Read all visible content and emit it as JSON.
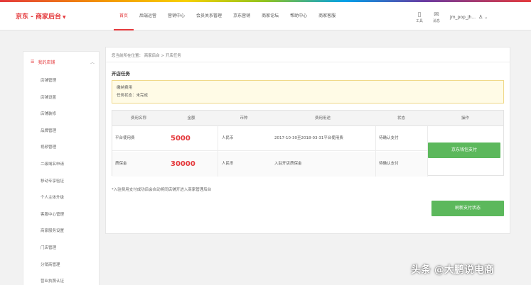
{
  "header": {
    "logo": "京东 - 商家后台",
    "nav": [
      "首页",
      "后端运营",
      "营销中心",
      "会员关系管理",
      "京东营销",
      "商家论坛",
      "帮助中心",
      "商家客服"
    ],
    "active_nav": 0,
    "icons": [
      {
        "icon": "mobile-icon",
        "label": "工具"
      },
      {
        "icon": "message-icon",
        "label": "消息"
      }
    ],
    "user": "jm_pop_jh..."
  },
  "sidebar": {
    "title": "我的店铺",
    "items": [
      "店铺管理",
      "店铺设置",
      "店铺装修",
      "品牌管理",
      "视频管理",
      "二级域名申请",
      "移动专享验证",
      "个人主体升级",
      "客服中心管理",
      "商家服务设置",
      "门店管理",
      "分销商管理",
      "营业执照认证"
    ]
  },
  "main": {
    "breadcrumb": "您当前所在位置： 商家后台 > 开店任务",
    "section_title": "开店任务",
    "notice": {
      "line1": "缴纳费用",
      "line2": "任务状态：未完成"
    },
    "table": {
      "headers": [
        "费用名称",
        "金额",
        "币种",
        "费用用途",
        "状态",
        "操作"
      ],
      "rows": [
        {
          "name": "平台使用费",
          "amount": "5000",
          "currency": "人民币",
          "usage": "2017-10-30至2018-03-31平台使用费",
          "status": "待确认支付"
        },
        {
          "name": "质保金",
          "amount": "30000",
          "currency": "人民币",
          "usage": "入驻开店质保金",
          "status": "待确认支付"
        }
      ],
      "action_button": "京东钱包支付"
    },
    "footnote": "*入驻费用支付成功后会自动将同店铺开进入商家管理后台",
    "refresh_button": "刷新支付状态"
  },
  "watermark": "头条 @大鹏说电商",
  "colors": {
    "accent": "#e4393c",
    "button": "#5cb85c",
    "notice_bg": "#fffbe6"
  }
}
